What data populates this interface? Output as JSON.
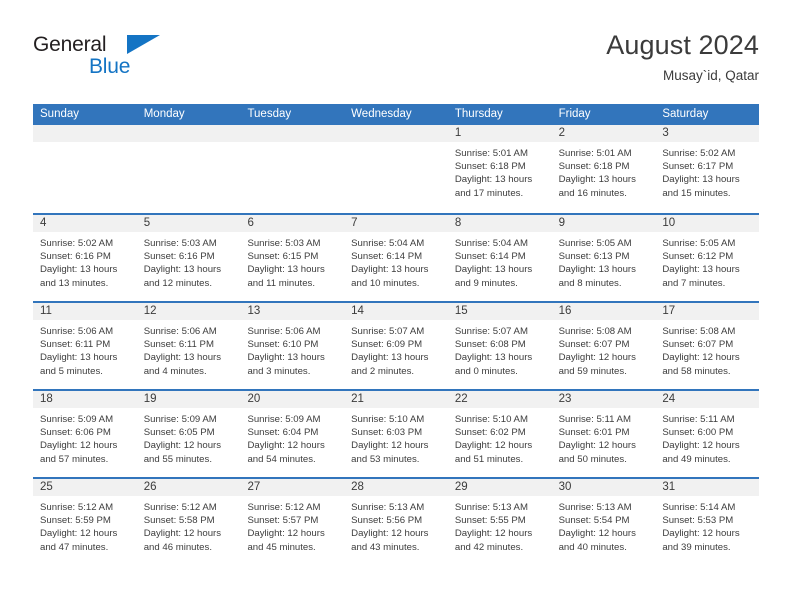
{
  "brand": {
    "line1": "General",
    "line2": "Blue"
  },
  "header": {
    "title": "August 2024",
    "subtitle": "Musay`id, Qatar"
  },
  "colors": {
    "header_blue": "#3275bc",
    "brand_blue": "#1474c4",
    "daynum_band": "#f1f1f1",
    "text": "#3d3d3d"
  },
  "calendar": {
    "weekdays": [
      "Sunday",
      "Monday",
      "Tuesday",
      "Wednesday",
      "Thursday",
      "Friday",
      "Saturday"
    ],
    "weeks": [
      [
        {
          "day": "",
          "empty": true,
          "sunrise": "",
          "sunset": "",
          "daylight1": "",
          "daylight2": ""
        },
        {
          "day": "",
          "empty": true,
          "sunrise": "",
          "sunset": "",
          "daylight1": "",
          "daylight2": ""
        },
        {
          "day": "",
          "empty": true,
          "sunrise": "",
          "sunset": "",
          "daylight1": "",
          "daylight2": ""
        },
        {
          "day": "",
          "empty": true,
          "sunrise": "",
          "sunset": "",
          "daylight1": "",
          "daylight2": ""
        },
        {
          "day": "1",
          "empty": false,
          "sunrise": "Sunrise: 5:01 AM",
          "sunset": "Sunset: 6:18 PM",
          "daylight1": "Daylight: 13 hours",
          "daylight2": "and 17 minutes."
        },
        {
          "day": "2",
          "empty": false,
          "sunrise": "Sunrise: 5:01 AM",
          "sunset": "Sunset: 6:18 PM",
          "daylight1": "Daylight: 13 hours",
          "daylight2": "and 16 minutes."
        },
        {
          "day": "3",
          "empty": false,
          "sunrise": "Sunrise: 5:02 AM",
          "sunset": "Sunset: 6:17 PM",
          "daylight1": "Daylight: 13 hours",
          "daylight2": "and 15 minutes."
        }
      ],
      [
        {
          "day": "4",
          "empty": false,
          "sunrise": "Sunrise: 5:02 AM",
          "sunset": "Sunset: 6:16 PM",
          "daylight1": "Daylight: 13 hours",
          "daylight2": "and 13 minutes."
        },
        {
          "day": "5",
          "empty": false,
          "sunrise": "Sunrise: 5:03 AM",
          "sunset": "Sunset: 6:16 PM",
          "daylight1": "Daylight: 13 hours",
          "daylight2": "and 12 minutes."
        },
        {
          "day": "6",
          "empty": false,
          "sunrise": "Sunrise: 5:03 AM",
          "sunset": "Sunset: 6:15 PM",
          "daylight1": "Daylight: 13 hours",
          "daylight2": "and 11 minutes."
        },
        {
          "day": "7",
          "empty": false,
          "sunrise": "Sunrise: 5:04 AM",
          "sunset": "Sunset: 6:14 PM",
          "daylight1": "Daylight: 13 hours",
          "daylight2": "and 10 minutes."
        },
        {
          "day": "8",
          "empty": false,
          "sunrise": "Sunrise: 5:04 AM",
          "sunset": "Sunset: 6:14 PM",
          "daylight1": "Daylight: 13 hours",
          "daylight2": "and 9 minutes."
        },
        {
          "day": "9",
          "empty": false,
          "sunrise": "Sunrise: 5:05 AM",
          "sunset": "Sunset: 6:13 PM",
          "daylight1": "Daylight: 13 hours",
          "daylight2": "and 8 minutes."
        },
        {
          "day": "10",
          "empty": false,
          "sunrise": "Sunrise: 5:05 AM",
          "sunset": "Sunset: 6:12 PM",
          "daylight1": "Daylight: 13 hours",
          "daylight2": "and 7 minutes."
        }
      ],
      [
        {
          "day": "11",
          "empty": false,
          "sunrise": "Sunrise: 5:06 AM",
          "sunset": "Sunset: 6:11 PM",
          "daylight1": "Daylight: 13 hours",
          "daylight2": "and 5 minutes."
        },
        {
          "day": "12",
          "empty": false,
          "sunrise": "Sunrise: 5:06 AM",
          "sunset": "Sunset: 6:11 PM",
          "daylight1": "Daylight: 13 hours",
          "daylight2": "and 4 minutes."
        },
        {
          "day": "13",
          "empty": false,
          "sunrise": "Sunrise: 5:06 AM",
          "sunset": "Sunset: 6:10 PM",
          "daylight1": "Daylight: 13 hours",
          "daylight2": "and 3 minutes."
        },
        {
          "day": "14",
          "empty": false,
          "sunrise": "Sunrise: 5:07 AM",
          "sunset": "Sunset: 6:09 PM",
          "daylight1": "Daylight: 13 hours",
          "daylight2": "and 2 minutes."
        },
        {
          "day": "15",
          "empty": false,
          "sunrise": "Sunrise: 5:07 AM",
          "sunset": "Sunset: 6:08 PM",
          "daylight1": "Daylight: 13 hours",
          "daylight2": "and 0 minutes."
        },
        {
          "day": "16",
          "empty": false,
          "sunrise": "Sunrise: 5:08 AM",
          "sunset": "Sunset: 6:07 PM",
          "daylight1": "Daylight: 12 hours",
          "daylight2": "and 59 minutes."
        },
        {
          "day": "17",
          "empty": false,
          "sunrise": "Sunrise: 5:08 AM",
          "sunset": "Sunset: 6:07 PM",
          "daylight1": "Daylight: 12 hours",
          "daylight2": "and 58 minutes."
        }
      ],
      [
        {
          "day": "18",
          "empty": false,
          "sunrise": "Sunrise: 5:09 AM",
          "sunset": "Sunset: 6:06 PM",
          "daylight1": "Daylight: 12 hours",
          "daylight2": "and 57 minutes."
        },
        {
          "day": "19",
          "empty": false,
          "sunrise": "Sunrise: 5:09 AM",
          "sunset": "Sunset: 6:05 PM",
          "daylight1": "Daylight: 12 hours",
          "daylight2": "and 55 minutes."
        },
        {
          "day": "20",
          "empty": false,
          "sunrise": "Sunrise: 5:09 AM",
          "sunset": "Sunset: 6:04 PM",
          "daylight1": "Daylight: 12 hours",
          "daylight2": "and 54 minutes."
        },
        {
          "day": "21",
          "empty": false,
          "sunrise": "Sunrise: 5:10 AM",
          "sunset": "Sunset: 6:03 PM",
          "daylight1": "Daylight: 12 hours",
          "daylight2": "and 53 minutes."
        },
        {
          "day": "22",
          "empty": false,
          "sunrise": "Sunrise: 5:10 AM",
          "sunset": "Sunset: 6:02 PM",
          "daylight1": "Daylight: 12 hours",
          "daylight2": "and 51 minutes."
        },
        {
          "day": "23",
          "empty": false,
          "sunrise": "Sunrise: 5:11 AM",
          "sunset": "Sunset: 6:01 PM",
          "daylight1": "Daylight: 12 hours",
          "daylight2": "and 50 minutes."
        },
        {
          "day": "24",
          "empty": false,
          "sunrise": "Sunrise: 5:11 AM",
          "sunset": "Sunset: 6:00 PM",
          "daylight1": "Daylight: 12 hours",
          "daylight2": "and 49 minutes."
        }
      ],
      [
        {
          "day": "25",
          "empty": false,
          "sunrise": "Sunrise: 5:12 AM",
          "sunset": "Sunset: 5:59 PM",
          "daylight1": "Daylight: 12 hours",
          "daylight2": "and 47 minutes."
        },
        {
          "day": "26",
          "empty": false,
          "sunrise": "Sunrise: 5:12 AM",
          "sunset": "Sunset: 5:58 PM",
          "daylight1": "Daylight: 12 hours",
          "daylight2": "and 46 minutes."
        },
        {
          "day": "27",
          "empty": false,
          "sunrise": "Sunrise: 5:12 AM",
          "sunset": "Sunset: 5:57 PM",
          "daylight1": "Daylight: 12 hours",
          "daylight2": "and 45 minutes."
        },
        {
          "day": "28",
          "empty": false,
          "sunrise": "Sunrise: 5:13 AM",
          "sunset": "Sunset: 5:56 PM",
          "daylight1": "Daylight: 12 hours",
          "daylight2": "and 43 minutes."
        },
        {
          "day": "29",
          "empty": false,
          "sunrise": "Sunrise: 5:13 AM",
          "sunset": "Sunset: 5:55 PM",
          "daylight1": "Daylight: 12 hours",
          "daylight2": "and 42 minutes."
        },
        {
          "day": "30",
          "empty": false,
          "sunrise": "Sunrise: 5:13 AM",
          "sunset": "Sunset: 5:54 PM",
          "daylight1": "Daylight: 12 hours",
          "daylight2": "and 40 minutes."
        },
        {
          "day": "31",
          "empty": false,
          "sunrise": "Sunrise: 5:14 AM",
          "sunset": "Sunset: 5:53 PM",
          "daylight1": "Daylight: 12 hours",
          "daylight2": "and 39 minutes."
        }
      ]
    ]
  }
}
